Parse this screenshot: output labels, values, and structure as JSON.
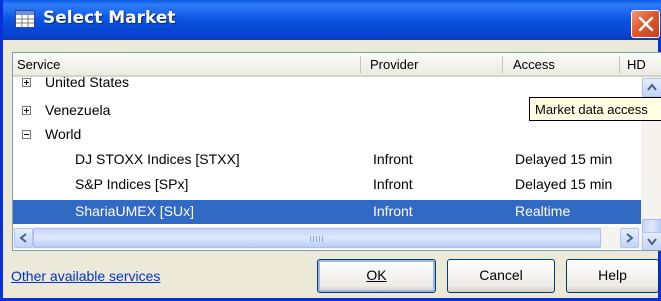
{
  "window": {
    "title": "Select Market",
    "close_glyph": "✕"
  },
  "columns": {
    "service": "Service",
    "provider": "Provider",
    "access": "Access",
    "hd": "HD"
  },
  "rows": [
    {
      "expander": "plus",
      "service": "United States",
      "provider": "",
      "access": "",
      "selected": false
    },
    {
      "expander": "plus",
      "service": "Venezuela",
      "provider": "",
      "access": "",
      "selected": false
    },
    {
      "expander": "minus",
      "service": "World",
      "provider": "",
      "access": "",
      "selected": false
    },
    {
      "expander": "",
      "service": "DJ STOXX Indices [STXX]",
      "provider": "Infront",
      "access": "Delayed 15 min",
      "selected": false
    },
    {
      "expander": "",
      "service": "S&P Indices [SPx]",
      "provider": "Infront",
      "access": "Delayed 15 min",
      "selected": false
    },
    {
      "expander": "",
      "service": "ShariaUMEX [SUx]",
      "provider": "Infront",
      "access": "Realtime",
      "selected": true
    }
  ],
  "tooltip": "Market data access",
  "footer": {
    "link": "Other available services",
    "ok": "OK",
    "cancel": "Cancel",
    "help": "Help"
  },
  "colors": {
    "title_bar": "#0a53e0",
    "selection": "#316ac5",
    "link": "#0033cc"
  },
  "icons": [
    "table-icon",
    "close-icon",
    "expand-icon",
    "collapse-icon",
    "scroll-up-icon",
    "scroll-down-icon",
    "scroll-left-icon",
    "scroll-right-icon"
  ]
}
